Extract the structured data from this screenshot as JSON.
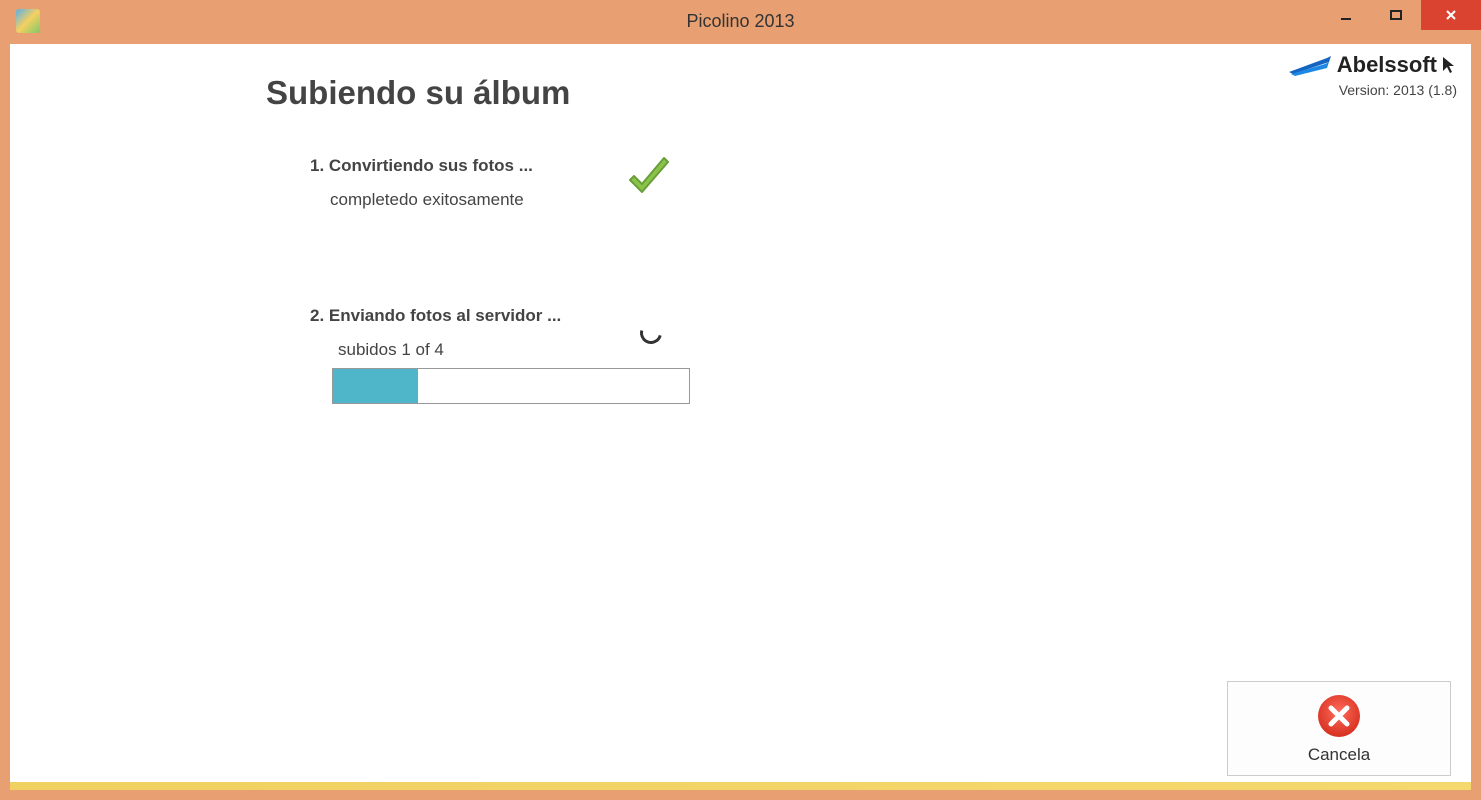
{
  "window": {
    "title": "Picolino 2013"
  },
  "brand": {
    "name": "Abelssoft",
    "version": "Version: 2013 (1.8)"
  },
  "main": {
    "heading": "Subiendo su álbum",
    "step1": {
      "title": "1. Convirtiendo sus fotos ...",
      "status": "completedo exitosamente"
    },
    "step2": {
      "title": "2. Enviando fotos al servidor ...",
      "status": "subidos 1 of 4",
      "progress_percent": 24
    }
  },
  "actions": {
    "cancel_label": "Cancela"
  }
}
